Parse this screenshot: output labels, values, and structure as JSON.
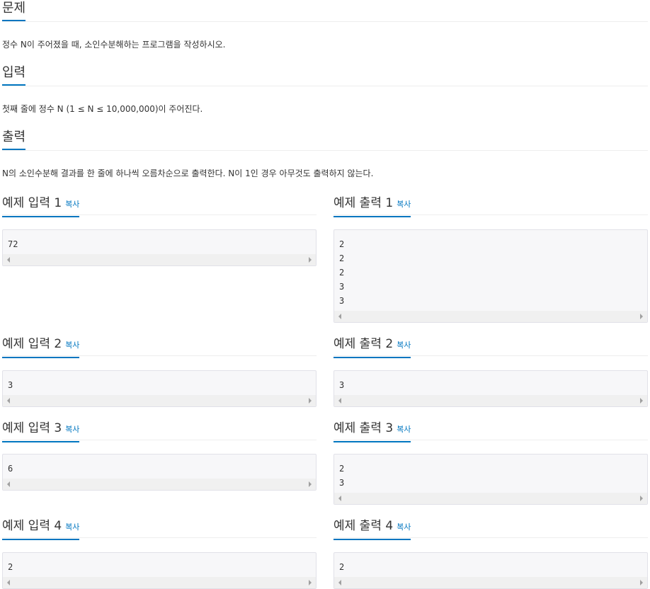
{
  "problem": {
    "title": "문제",
    "text": "정수 N이 주어졌을 때, 소인수분해하는 프로그램을 작성하시오."
  },
  "input": {
    "title": "입력",
    "text": "첫째 줄에 정수 N (1 ≤ N ≤ 10,000,000)이 주어진다."
  },
  "output": {
    "title": "출력",
    "text": "N의 소인수분해 결과를 한 줄에 하나씩 오름차순으로 출력한다. N이 1인 경우 아무것도 출력하지 않는다."
  },
  "copy_label": "복사",
  "samples": [
    {
      "in_title": "예제 입력 1",
      "in": "72",
      "out_title": "예제 출력 1",
      "out": "2\n2\n2\n3\n3"
    },
    {
      "in_title": "예제 입력 2",
      "in": "3",
      "out_title": "예제 출력 2",
      "out": "3"
    },
    {
      "in_title": "예제 입력 3",
      "in": "6",
      "out_title": "예제 출력 3",
      "out": "2\n3"
    },
    {
      "in_title": "예제 입력 4",
      "in": "2",
      "out_title": "예제 출력 4",
      "out": "2"
    }
  ]
}
